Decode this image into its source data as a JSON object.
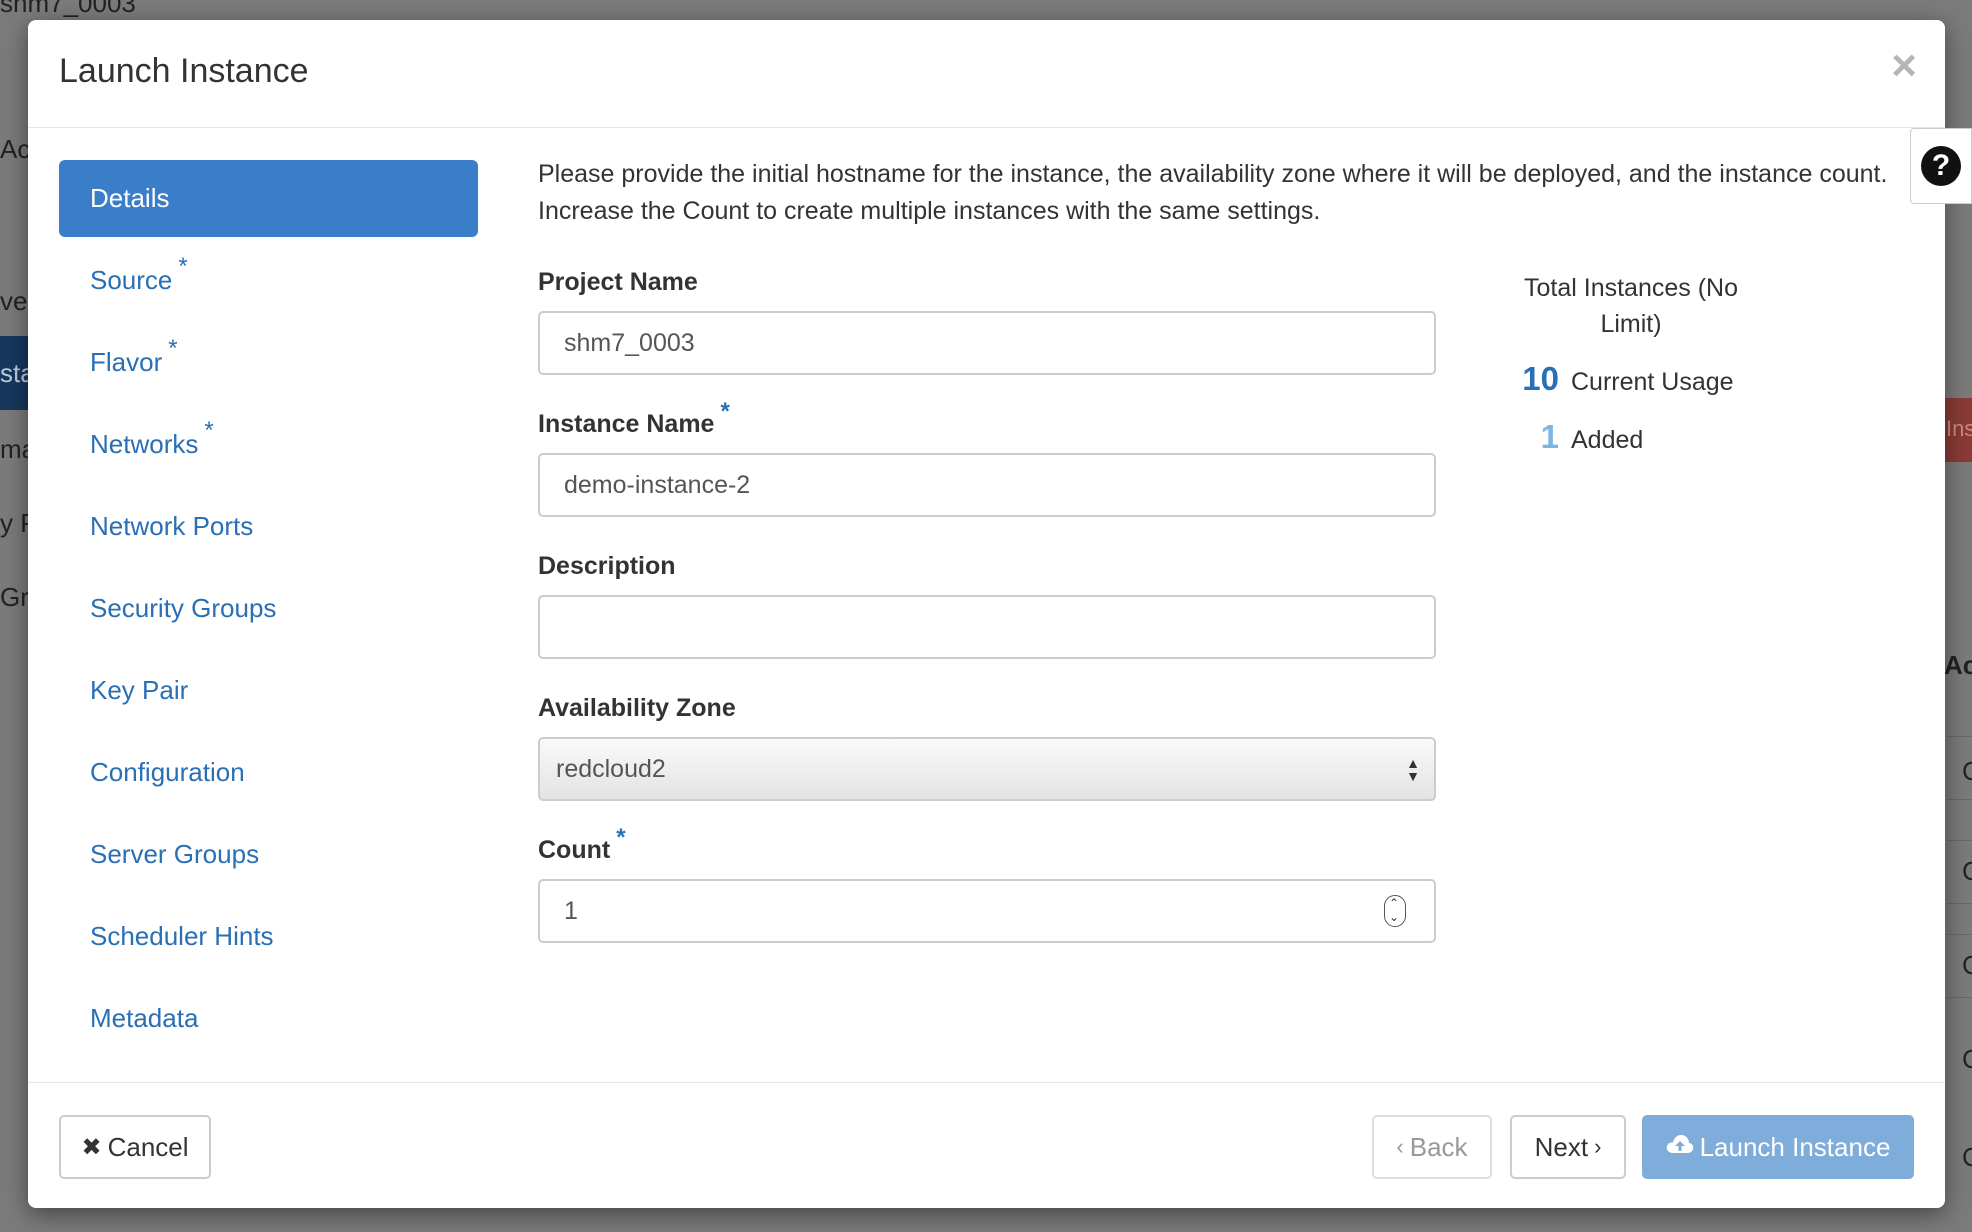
{
  "background": {
    "fragments": [
      "shm7_0003",
      "Acc",
      "ver",
      "sta",
      "ma",
      "y P",
      "Gro",
      "Ac",
      "Ins",
      "C",
      "C",
      "C",
      "C",
      "C"
    ]
  },
  "modal": {
    "title": "Launch Instance",
    "close_icon": "×",
    "help_icon": "?"
  },
  "nav": {
    "items": [
      {
        "label": "Details",
        "required": false,
        "active": true
      },
      {
        "label": "Source",
        "required": true
      },
      {
        "label": "Flavor",
        "required": true
      },
      {
        "label": "Networks",
        "required": true
      },
      {
        "label": "Network Ports",
        "required": false
      },
      {
        "label": "Security Groups",
        "required": false
      },
      {
        "label": "Key Pair",
        "required": false
      },
      {
        "label": "Configuration",
        "required": false
      },
      {
        "label": "Server Groups",
        "required": false
      },
      {
        "label": "Scheduler Hints",
        "required": false
      },
      {
        "label": "Metadata",
        "required": false
      }
    ],
    "required_marker": "*"
  },
  "content": {
    "intro": "Please provide the initial hostname for the instance, the availability zone where it will be deployed, and the instance count. Increase the Count to create multiple instances with the same settings.",
    "fields": {
      "project_name": {
        "label": "Project Name",
        "value": "shm7_0003"
      },
      "instance_name": {
        "label": "Instance Name",
        "value": "demo-instance-2"
      },
      "description": {
        "label": "Description",
        "value": ""
      },
      "availability_zone": {
        "label": "Availability Zone",
        "value": "redcloud2"
      },
      "count": {
        "label": "Count",
        "value": "1"
      }
    }
  },
  "quota": {
    "title": "Total Instances (No Limit)",
    "current_usage": {
      "value": "10",
      "label": "Current Usage"
    },
    "added": {
      "value": "1",
      "label": "Added"
    }
  },
  "footer": {
    "cancel": "Cancel",
    "back": "Back",
    "next": "Next",
    "launch": "Launch Instance"
  },
  "colors": {
    "accent": "#3a7dc9",
    "link": "#2a6fb5",
    "launch_disabled": "#7eaddb"
  }
}
